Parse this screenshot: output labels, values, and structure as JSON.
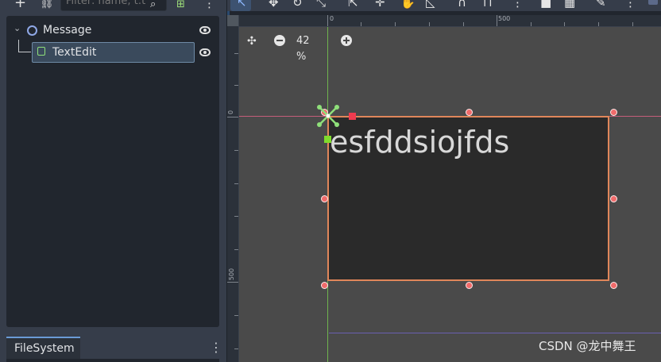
{
  "scene_dock": {
    "add_icon": "plus-icon",
    "link_icon": "link-icon",
    "filter_placeholder": "Filter: name, t:t",
    "search_icon": "search-icon",
    "add_child_icon": "add-scene-icon",
    "menu_icon": "vertical-dots-icon",
    "tree": [
      {
        "label": "Message",
        "icon": "node-circle-icon",
        "visible": true
      },
      {
        "label": "TextEdit",
        "icon": "textedit-icon",
        "visible": true,
        "selected": true
      }
    ]
  },
  "filesystem_dock": {
    "tab_label": "FileSystem",
    "menu_icon": "vertical-dots-icon"
  },
  "viewport": {
    "zoom_percent": "42 %",
    "ruler_top_labels": [
      "0",
      "500"
    ],
    "ruler_left_labels": [
      "0",
      "500"
    ],
    "textedit_text": "esfddsiojfds",
    "colors": {
      "selection_border": "#e0865a",
      "guide_vertical": "#6fb44e",
      "guide_horizontal": "#c55d7a",
      "anchor": "#7fdc2c",
      "canvas_bg": "#4a4a4a"
    }
  },
  "watermark": "CSDN @龙中舞王"
}
